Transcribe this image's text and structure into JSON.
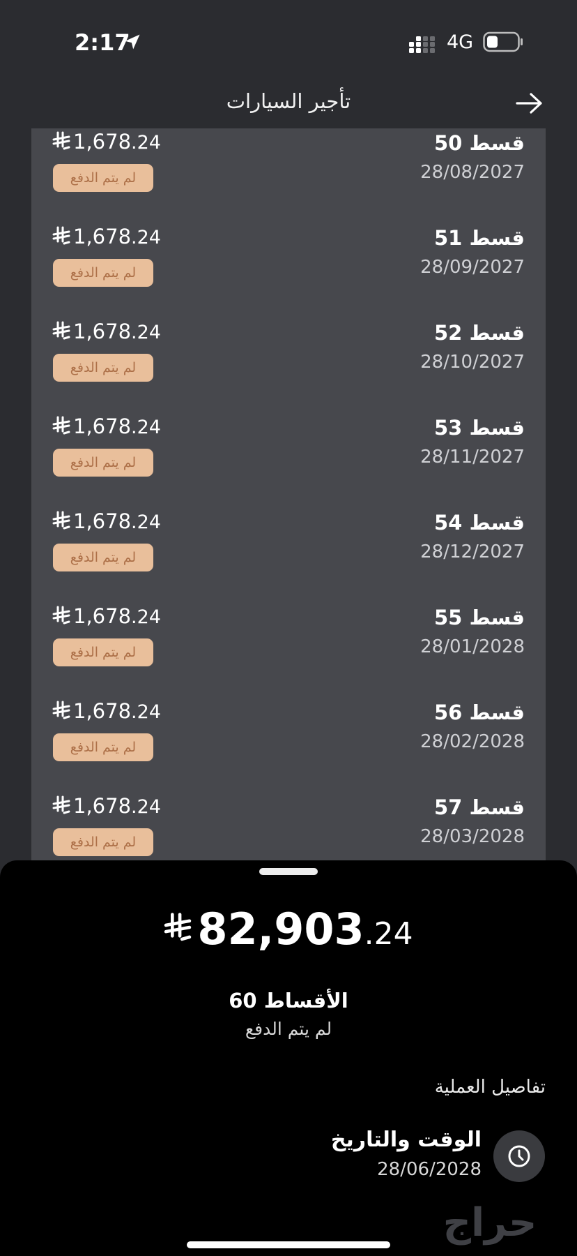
{
  "status_bar": {
    "time": "2:17",
    "network": "4G",
    "icons": [
      "location-arrow-icon",
      "signal-icon",
      "battery-icon"
    ]
  },
  "header": {
    "title": "تأجير السيارات",
    "back_icon": "arrow-right-icon"
  },
  "installments": [
    {
      "title": "قسط 50",
      "date": "28/08/2027",
      "amount_int": "1,678",
      "amount_dec": ".24",
      "status": "لم يتم الدفع"
    },
    {
      "title": "قسط 51",
      "date": "28/09/2027",
      "amount_int": "1,678",
      "amount_dec": ".24",
      "status": "لم يتم الدفع"
    },
    {
      "title": "قسط 52",
      "date": "28/10/2027",
      "amount_int": "1,678",
      "amount_dec": ".24",
      "status": "لم يتم الدفع"
    },
    {
      "title": "قسط 53",
      "date": "28/11/2027",
      "amount_int": "1,678",
      "amount_dec": ".24",
      "status": "لم يتم الدفع"
    },
    {
      "title": "قسط 54",
      "date": "28/12/2027",
      "amount_int": "1,678",
      "amount_dec": ".24",
      "status": "لم يتم الدفع"
    },
    {
      "title": "قسط 55",
      "date": "28/01/2028",
      "amount_int": "1,678",
      "amount_dec": ".24",
      "status": "لم يتم الدفع"
    },
    {
      "title": "قسط 56",
      "date": "28/02/2028",
      "amount_int": "1,678",
      "amount_dec": ".24",
      "status": "لم يتم الدفع"
    },
    {
      "title": "قسط 57",
      "date": "28/03/2028",
      "amount_int": "1,678",
      "amount_dec": ".24",
      "status": "لم يتم الدفع"
    }
  ],
  "summary": {
    "total_int": "82,903",
    "total_dec": ".24",
    "count_label": "الأقساط 60",
    "status": "لم يتم الدفع",
    "details_title": "تفاصيل العملية",
    "datetime_label": "الوقت والتاريخ",
    "datetime_value": "28/06/2028"
  },
  "watermark": {
    "text": "حراج"
  },
  "colors": {
    "background": "#2b2c30",
    "card": "#47484d",
    "badge_bg": "#e9bf9b",
    "badge_text": "#ad7048",
    "sheet": "#000000"
  }
}
